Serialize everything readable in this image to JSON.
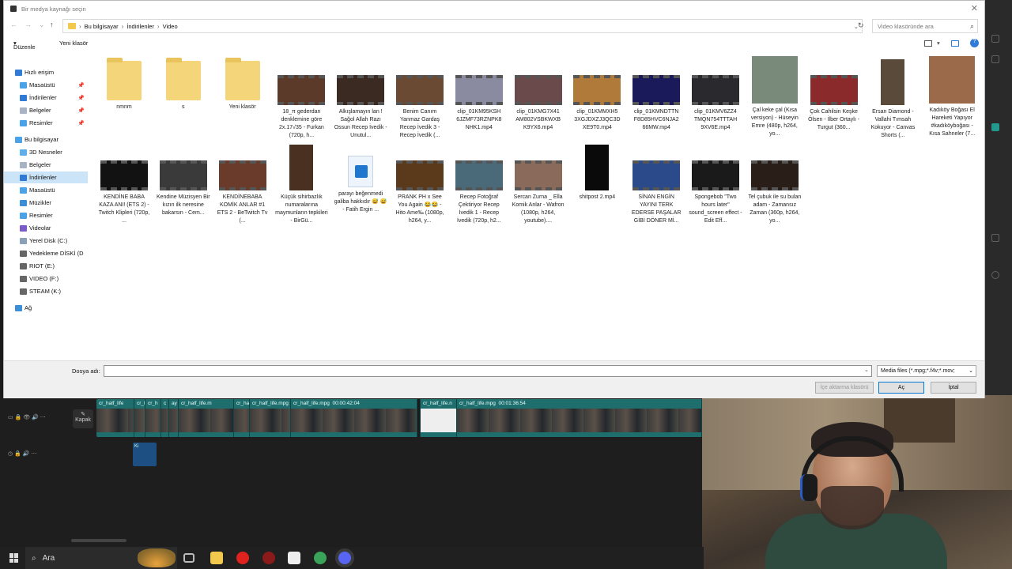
{
  "dialog": {
    "title": "Bir medya kaynağı seçin",
    "close": "✕"
  },
  "address": {
    "parts": [
      "Bu bilgisayar",
      "İndirilenler",
      "Video"
    ],
    "search_placeholder": "Video klasöründe ara"
  },
  "toolbar": {
    "organize": "Düzenle",
    "new_folder": "Yeni klasör"
  },
  "sidebar": {
    "items": [
      {
        "label": "Hızlı erişim",
        "pinned": false,
        "color": "#2f7bd6"
      },
      {
        "label": "Masaüstü",
        "pinned": true,
        "color": "#4aa3e8"
      },
      {
        "label": "İndirilenler",
        "pinned": true,
        "color": "#2f7bd6"
      },
      {
        "label": "Belgeler",
        "pinned": true,
        "color": "#a8b4c4"
      },
      {
        "label": "Resimler",
        "pinned": true,
        "color": "#4aa3e8"
      },
      {
        "label": "Bu bilgisayar",
        "pinned": false,
        "color": "#4aa3e8"
      },
      {
        "label": "3D Nesneler",
        "pinned": false,
        "color": "#5fb0ea"
      },
      {
        "label": "Belgeler",
        "pinned": false,
        "color": "#a8b4c4"
      },
      {
        "label": "İndirilenler",
        "pinned": false,
        "color": "#2f7bd6"
      },
      {
        "label": "Masaüstü",
        "pinned": false,
        "color": "#4aa3e8"
      },
      {
        "label": "Müzikler",
        "pinned": false,
        "color": "#3b8fd8"
      },
      {
        "label": "Resimler",
        "pinned": false,
        "color": "#4aa3e8"
      },
      {
        "label": "Videolar",
        "pinned": false,
        "color": "#7a5bc8"
      },
      {
        "label": "Yerel Disk (C:)",
        "pinned": false,
        "color": "#8aa0b8"
      },
      {
        "label": "Yedekleme DİSKİ (D",
        "pinned": false,
        "color": "#666666"
      },
      {
        "label": "RIOT (E:)",
        "pinned": false,
        "color": "#666666"
      },
      {
        "label": "VIDEO (F:)",
        "pinned": false,
        "color": "#666666"
      },
      {
        "label": "STEAM (K:)",
        "pinned": false,
        "color": "#666666"
      },
      {
        "label": "Ağ",
        "pinned": false,
        "color": "#3b8fd8"
      }
    ],
    "selected": "İndirilenler"
  },
  "files": [
    {
      "name": "nmnm",
      "kind": "folder"
    },
    {
      "name": "s",
      "kind": "folder"
    },
    {
      "name": "Yeni klasör",
      "kind": "folder"
    },
    {
      "name": "18_π gederdan denklemine göre 2x.17√35 - Furkan (720p, h...",
      "kind": "video",
      "color": "#5b3a2a"
    },
    {
      "name": "Alkışlamayın lan ! Sağol Allah Razı Ossun Recep İvedik - Unutul...",
      "kind": "video",
      "color": "#3a2a22"
    },
    {
      "name": "Benim Canım Yanmaz Gardaş Recep İvedik 3 - Recep İvedik (...",
      "kind": "video",
      "color": "#6a4a32"
    },
    {
      "name": "clip_01KM95KSH 6JZMF73RZNPK8 NHK1.mp4",
      "kind": "video",
      "color": "#8a8aa0"
    },
    {
      "name": "clip_01KMG7X41 AM802VSBKWXB K9YX6.mp4",
      "kind": "video",
      "color": "#6a4a4a"
    },
    {
      "name": "clip_01KMMXH5 3XGJDXZJ3QC3D XE9T0.mp4",
      "kind": "video",
      "color": "#b07a3a"
    },
    {
      "name": "clip_01KMNDTTN F8D85HVC6NJA2 66MW.mp4",
      "kind": "video",
      "color": "#1a1a5a"
    },
    {
      "name": "clip_01KMV6ZZ4 TMQN754TTTAH 9XV6E.mp4",
      "kind": "video",
      "color": "#2a2a2e"
    },
    {
      "name": "Çal keke çal (Kısa versiyon) - Hüseyin Emre (480p, h264, yo...",
      "kind": "tall",
      "color": "#7a8a7a"
    },
    {
      "name": "Çok Cahilsin Keşke Ölsen - İlber Ortaylı - Turgut (360...",
      "kind": "video",
      "color": "#8a2a2a"
    },
    {
      "name": "Ersan Diamond - Vallahi Tımsah Kokuyor - Canvas Shorts (...",
      "kind": "narrow",
      "color": "#5a4a3a"
    },
    {
      "name": "Kadıköy Boğası El Hareketi Yapıyor #kadıköyboğası - Kısa Sahneler (7...",
      "kind": "tall",
      "color": "#9a6a4a"
    },
    {
      "name": "KENDİNE BABA KAZA ANI! (ETS 2) - Twitch Klipleri (720p, ...",
      "kind": "video",
      "color": "#121212"
    },
    {
      "name": "Kendine Müzisyen Bir kızın ilk neresine bakarsın - Cem...",
      "kind": "video",
      "color": "#3a3a3a"
    },
    {
      "name": "KENDİNEBABA KOMİK ANLAR #1 ETS 2 - BeTwitch Tv (...",
      "kind": "video",
      "color": "#6a3a2a"
    },
    {
      "name": "Küçük sihirbazlık numaralarına maymunların tepkileri - BirGü...",
      "kind": "narrow",
      "color": "#4a3020"
    },
    {
      "name": "parayı beğenmedi galiba hakkıdır 😅 😅 - Fatih Ergin ...",
      "kind": "file",
      "color": "#1f77d0"
    },
    {
      "name": "PRANK PH x See You Again 😂😂 - Hito Ame‰ (1080p, h264, y...",
      "kind": "video",
      "color": "#5a3a1a"
    },
    {
      "name": "Recep Fotoğraf Çektiriyor  Recep İvedik 1 - Recep İvedik (720p, h2...",
      "kind": "video",
      "color": "#4a6a7a"
    },
    {
      "name": "Sercan Zurna _ Ella Komik Anlar - Wafron (1080p, h264, youtube)....",
      "kind": "video",
      "color": "#8a6a5a"
    },
    {
      "name": "shitpost 2.mp4",
      "kind": "narrow",
      "color": "#0a0a0a"
    },
    {
      "name": "SİNAN ENGİN YAYINI TERK EDERSE PAŞALAR GİBİ DÖNER Mİ...",
      "kind": "video",
      "color": "#2a4a8a"
    },
    {
      "name": "Spongebob \"Two hours later\" sound_screen effect - Edit Eff...",
      "kind": "video",
      "color": "#1a1a1a"
    },
    {
      "name": "Tel çubuk ile su bulan adam - Zamansız Zaman (360p, h264, yo...",
      "kind": "video",
      "color": "#2a1e18"
    }
  ],
  "footer": {
    "filename_label": "Dosya adı:",
    "filename_value": "",
    "filter": "Media files (*.mpg;*.f4v;*.mov;",
    "import_folder": "İçe aktarma klasörü",
    "open": "Aç",
    "cancel": "İptal"
  },
  "timeline": {
    "cover_label": "Kapak",
    "clips": [
      {
        "label": "cr_half_life",
        "duration": ""
      },
      {
        "label": "cr_l",
        "duration": ""
      },
      {
        "label": "cr_h",
        "duration": ""
      },
      {
        "label": "c",
        "duration": ""
      },
      {
        "label": "ay",
        "duration": ""
      },
      {
        "label": "cr_half_life.m",
        "duration": ""
      },
      {
        "label": "cr_ha",
        "duration": ""
      },
      {
        "label": "cr_half_life.mpg",
        "duration": ""
      },
      {
        "label": "cr_half_life.mpg",
        "duration": "00:00:42:04"
      },
      {
        "label": "cr_half_life.n",
        "duration": ""
      },
      {
        "label": "cr_half_life.mpg",
        "duration": "00:01:36:54"
      }
    ],
    "audio_clip": "Ki"
  },
  "taskbar": {
    "search": "Ara"
  }
}
